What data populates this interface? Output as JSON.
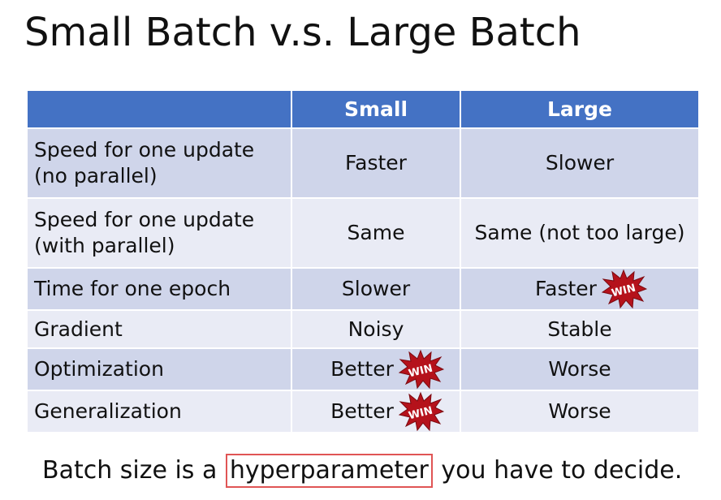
{
  "slide": {
    "title": "Small Batch v.s. Large Batch"
  },
  "table": {
    "headers": [
      "",
      "Small",
      "Large"
    ],
    "rows": [
      {
        "label_line1": "Speed for one update",
        "label_line2": "(no parallel)",
        "small": "Faster",
        "large": "Slower",
        "small_win": false,
        "large_win": false
      },
      {
        "label_line1": "Speed for one update",
        "label_line2": "(with parallel)",
        "small": "Same",
        "large": "Same (not too large)",
        "small_win": false,
        "large_win": false
      },
      {
        "label_line1": "Time for one epoch",
        "label_line2": "",
        "small": "Slower",
        "large": "Faster",
        "small_win": false,
        "large_win": true
      },
      {
        "label_line1": "Gradient",
        "label_line2": "",
        "small": "Noisy",
        "large": "Stable",
        "small_win": false,
        "large_win": false
      },
      {
        "label_line1": "Optimization",
        "label_line2": "",
        "small": "Better",
        "large": "Worse",
        "small_win": true,
        "large_win": false
      },
      {
        "label_line1": "Generalization",
        "label_line2": "",
        "small": "Better",
        "large": "Worse",
        "small_win": true,
        "large_win": false
      }
    ]
  },
  "win_badge": {
    "text": "WIN",
    "color": "#B5121B",
    "icon": "win-burst-icon"
  },
  "footer": {
    "prefix": "Batch size is a ",
    "highlight": "hyperparameter",
    "suffix": " you have to decide."
  },
  "colors": {
    "header_bg": "#4472C4",
    "row_dark": "#CFD5EA",
    "row_light": "#E9EBF5",
    "highlight_border": "#E05555"
  }
}
